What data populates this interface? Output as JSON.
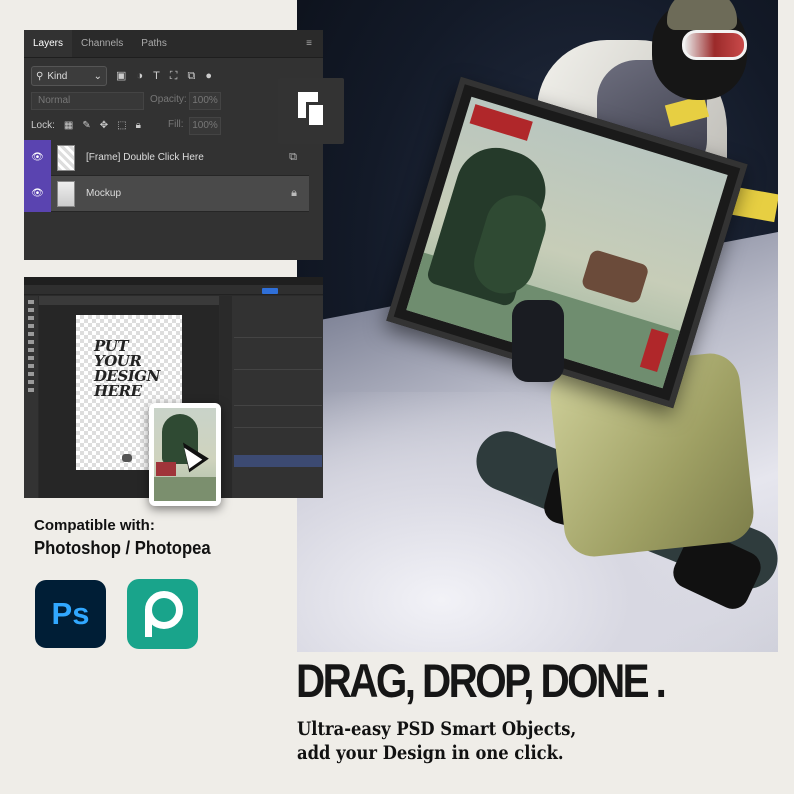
{
  "layers_panel": {
    "tabs": [
      "Layers",
      "Channels",
      "Paths"
    ],
    "kind_filter": "Kind",
    "blend_mode": "Normal",
    "opacity_label": "Opacity:",
    "opacity_value": "100%",
    "lock_label": "Lock:",
    "fill_label": "Fill:",
    "fill_value": "100%",
    "layers": [
      {
        "name": "[Frame] Double Click Here",
        "badge": "smart-object-icon"
      },
      {
        "name": "Mockup",
        "badge": "lock-icon"
      }
    ]
  },
  "photoshop_window": {
    "canvas_text": "PUT YOUR DESIGN HERE"
  },
  "compatibility": {
    "title": "Compatible with:",
    "apps": "Photoshop / Photopea",
    "ps_logo_text": "Ps"
  },
  "headline": {
    "main": "DRAG, DROP, DONE .",
    "line1": "Ultra-easy PSD Smart Objects,",
    "line2": "add your Design in one click."
  },
  "colors": {
    "background": "#efede8",
    "ps_blue": "#31a8ff",
    "photopea_green": "#19a48b",
    "layer_highlight": "#5a44b0"
  }
}
